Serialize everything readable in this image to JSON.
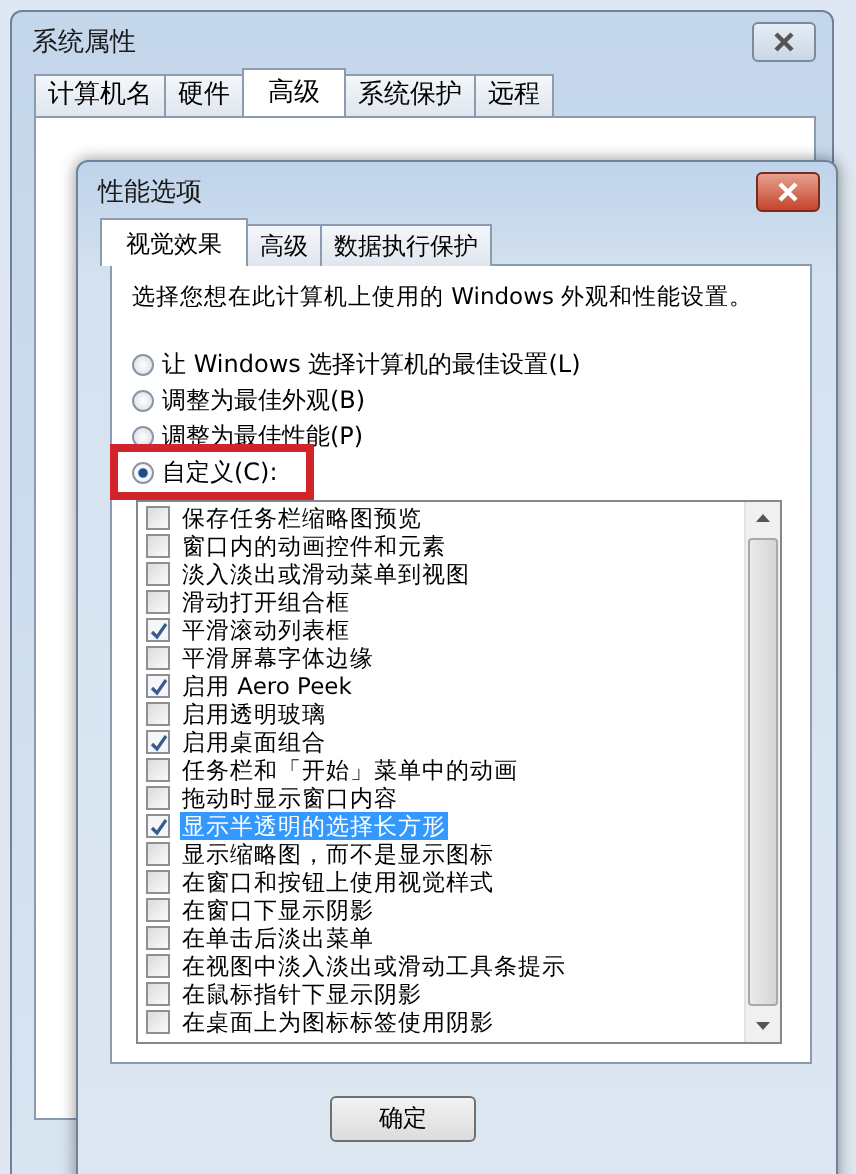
{
  "back_window": {
    "title": "系统属性",
    "tabs": [
      {
        "label": "计算机名",
        "selected": false
      },
      {
        "label": "硬件",
        "selected": false
      },
      {
        "label": "高级",
        "selected": true
      },
      {
        "label": "系统保护",
        "selected": false
      },
      {
        "label": "远程",
        "selected": false
      }
    ]
  },
  "dialog": {
    "title": "性能选项",
    "tabs": [
      {
        "label": "视觉效果",
        "selected": true
      },
      {
        "label": "高级",
        "selected": false
      },
      {
        "label": "数据执行保护",
        "selected": false
      }
    ],
    "intro": "选择您想在此计算机上使用的 Windows 外观和性能设置。",
    "options": [
      {
        "label": "让 Windows 选择计算机的最佳设置(L)",
        "selected": false
      },
      {
        "label": "调整为最佳外观(B)",
        "selected": false
      },
      {
        "label": "调整为最佳性能(P)",
        "selected": false
      },
      {
        "label": "自定义(C):",
        "selected": true
      }
    ],
    "effects": [
      {
        "label": "保存任务栏缩略图预览",
        "checked": false,
        "selected": false
      },
      {
        "label": "窗口内的动画控件和元素",
        "checked": false,
        "selected": false
      },
      {
        "label": "淡入淡出或滑动菜单到视图",
        "checked": false,
        "selected": false
      },
      {
        "label": "滑动打开组合框",
        "checked": false,
        "selected": false
      },
      {
        "label": "平滑滚动列表框",
        "checked": true,
        "selected": false
      },
      {
        "label": "平滑屏幕字体边缘",
        "checked": false,
        "selected": false
      },
      {
        "label": "启用 Aero Peek",
        "checked": true,
        "selected": false
      },
      {
        "label": "启用透明玻璃",
        "checked": false,
        "selected": false
      },
      {
        "label": "启用桌面组合",
        "checked": true,
        "selected": false
      },
      {
        "label": "任务栏和「开始」菜单中的动画",
        "checked": false,
        "selected": false
      },
      {
        "label": "拖动时显示窗口内容",
        "checked": false,
        "selected": false
      },
      {
        "label": "显示半透明的选择长方形",
        "checked": true,
        "selected": true
      },
      {
        "label": "显示缩略图，而不是显示图标",
        "checked": false,
        "selected": false
      },
      {
        "label": "在窗口和按钮上使用视觉样式",
        "checked": false,
        "selected": false
      },
      {
        "label": "在窗口下显示阴影",
        "checked": false,
        "selected": false
      },
      {
        "label": "在单击后淡出菜单",
        "checked": false,
        "selected": false
      },
      {
        "label": "在视图中淡入淡出或滑动工具条提示",
        "checked": false,
        "selected": false
      },
      {
        "label": "在鼠标指针下显示阴影",
        "checked": false,
        "selected": false
      },
      {
        "label": "在桌面上为图标标签使用阴影",
        "checked": false,
        "selected": false
      }
    ],
    "buttons": [
      "确定"
    ]
  }
}
